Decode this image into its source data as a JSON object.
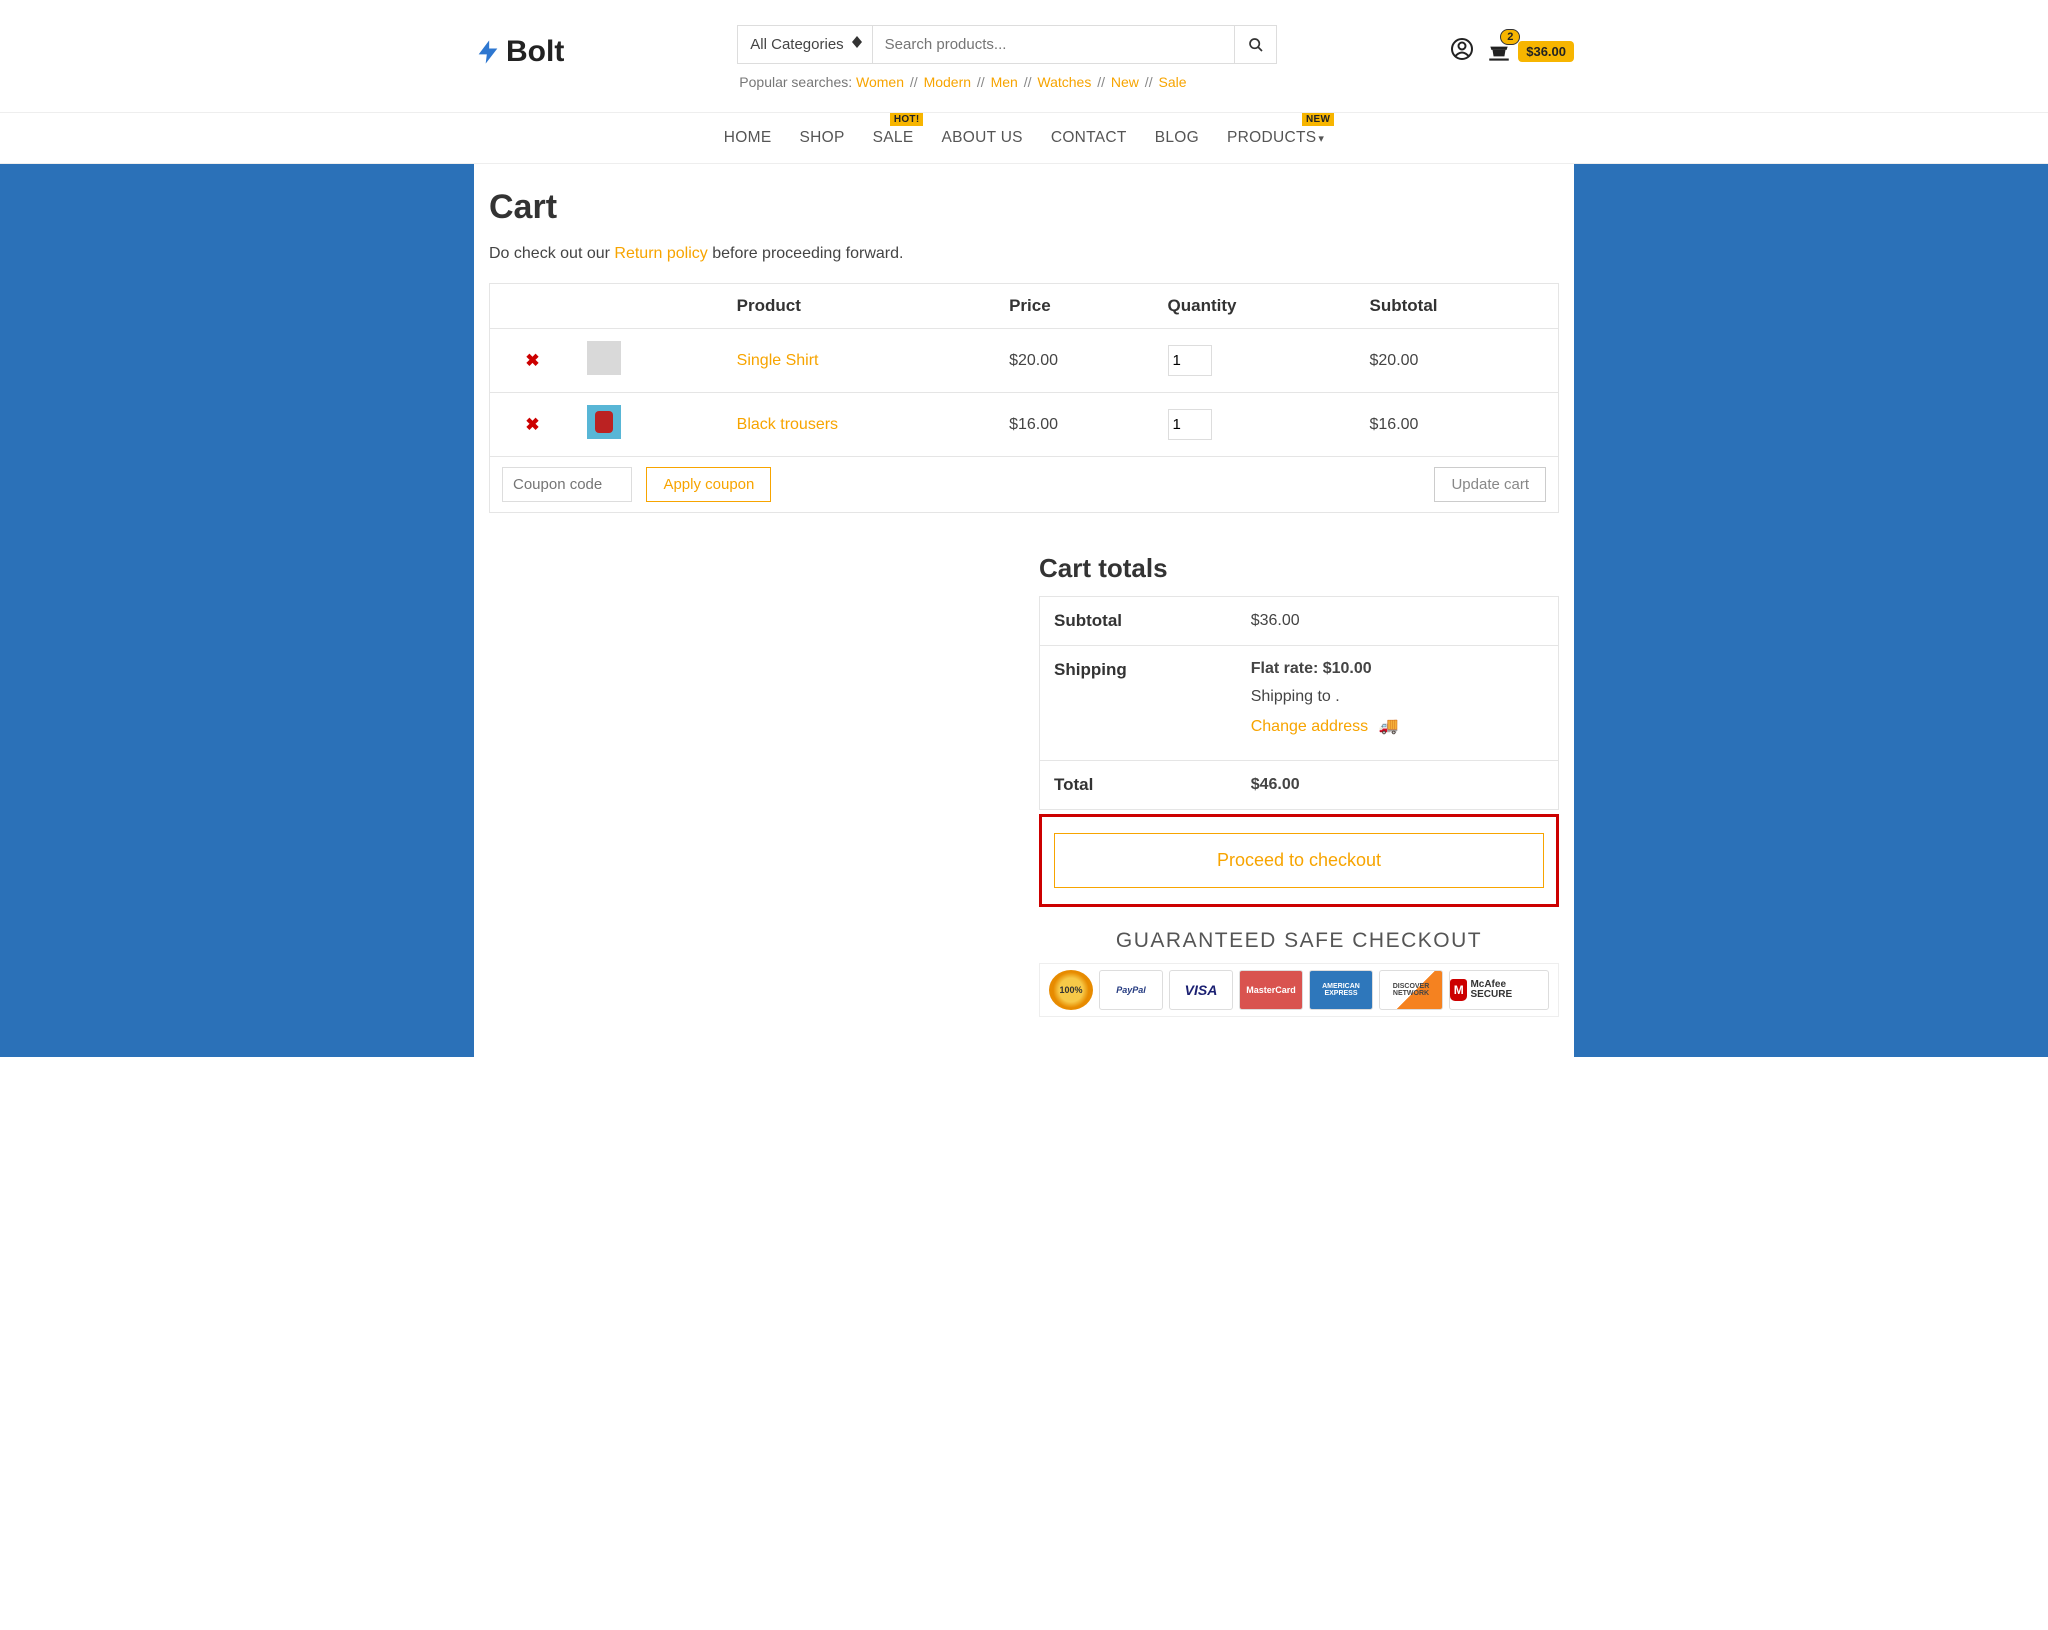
{
  "logo": "Bolt",
  "search": {
    "category": "All Categories",
    "placeholder": "Search products..."
  },
  "popular": {
    "label": "Popular searches:",
    "links": [
      "Women",
      "Modern",
      "Men",
      "Watches",
      "New",
      "Sale"
    ]
  },
  "headerCart": {
    "count": "2",
    "total": "$36.00"
  },
  "nav": {
    "items": [
      "HOME",
      "SHOP",
      "SALE",
      "ABOUT US",
      "CONTACT",
      "BLOG",
      "PRODUCTS"
    ],
    "saleBadge": "HOT!",
    "productsBadge": "NEW"
  },
  "page": {
    "title": "Cart",
    "introPre": "Do check out our ",
    "introLink": "Return policy",
    "introPost": " before proceeding forward."
  },
  "tableHead": {
    "product": "Product",
    "price": "Price",
    "quantity": "Quantity",
    "subtotal": "Subtotal"
  },
  "items": [
    {
      "name": "Single Shirt",
      "price": "$20.00",
      "qty": "1",
      "subtotal": "$20.00"
    },
    {
      "name": "Black trousers",
      "price": "$16.00",
      "qty": "1",
      "subtotal": "$16.00"
    }
  ],
  "coupon": {
    "placeholder": "Coupon code",
    "apply": "Apply coupon",
    "update": "Update cart"
  },
  "totals": {
    "title": "Cart totals",
    "subtotalLabel": "Subtotal",
    "subtotal": "$36.00",
    "shippingLabel": "Shipping",
    "flatRate": "Flat rate: $10.00",
    "shipTo": "Shipping to   .",
    "change": "Change address",
    "totalLabel": "Total",
    "total": "$46.00",
    "checkout": "Proceed to checkout"
  },
  "safe": {
    "title": "GUARANTEED SAFE CHECKOUT",
    "seal": "100%",
    "paypal": "PayPal",
    "visa": "VISA",
    "mc": "MasterCard",
    "amex": "AMERICAN EXPRESS",
    "disc": "DISCOVER NETWORK",
    "mcafeeM": "M",
    "mcafee": "McAfee SECURE"
  }
}
